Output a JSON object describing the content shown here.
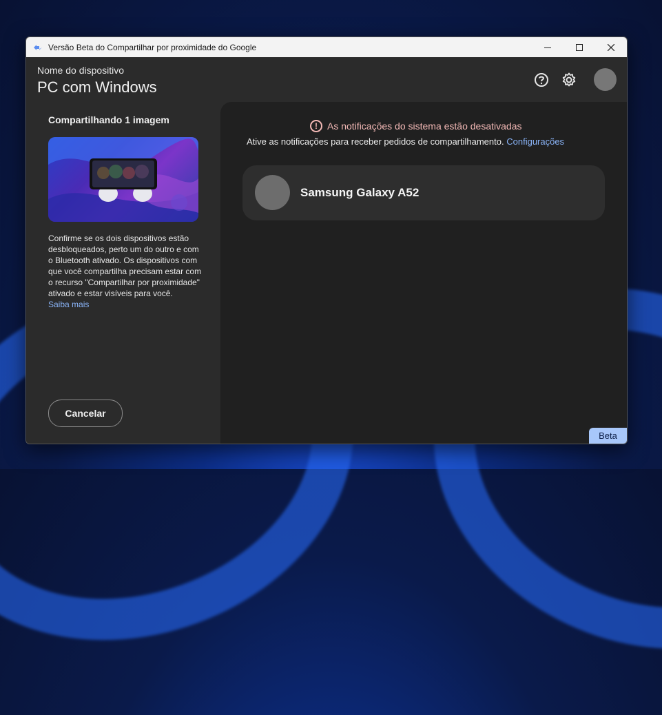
{
  "window": {
    "title": "Versão Beta do Compartilhar por proximidade do Google",
    "minimize_icon": "minimize-icon",
    "maximize_icon": "maximize-icon",
    "close_icon": "close-icon"
  },
  "header": {
    "device_label": "Nome do dispositivo",
    "device_name": "PC com Windows",
    "help_icon": "help-icon",
    "settings_icon": "gear-icon"
  },
  "left": {
    "share_title": "Compartilhando 1 imagem",
    "description": "Confirme se os dois dispositivos estão desbloqueados, perto um do outro e com o Bluetooth ativado. Os dispositivos com que você compartilha precisam estar com o recurso \"Compartilhar por proximidade\" ativado e estar visíveis para você.",
    "learn_more": "Saiba mais",
    "cancel_label": "Cancelar"
  },
  "right": {
    "warning": "As notificações do sistema estão desativadas",
    "info": "Ative as notificações para receber pedidos de compartilhamento.",
    "config_link": "Configurações",
    "devices": [
      {
        "name": "Samsung Galaxy A52"
      }
    ]
  },
  "badge": {
    "beta": "Beta"
  },
  "colors": {
    "accent_link": "#8ab4f8",
    "warning": "#f2b8b5",
    "beta_bg": "#a8c7fa"
  }
}
